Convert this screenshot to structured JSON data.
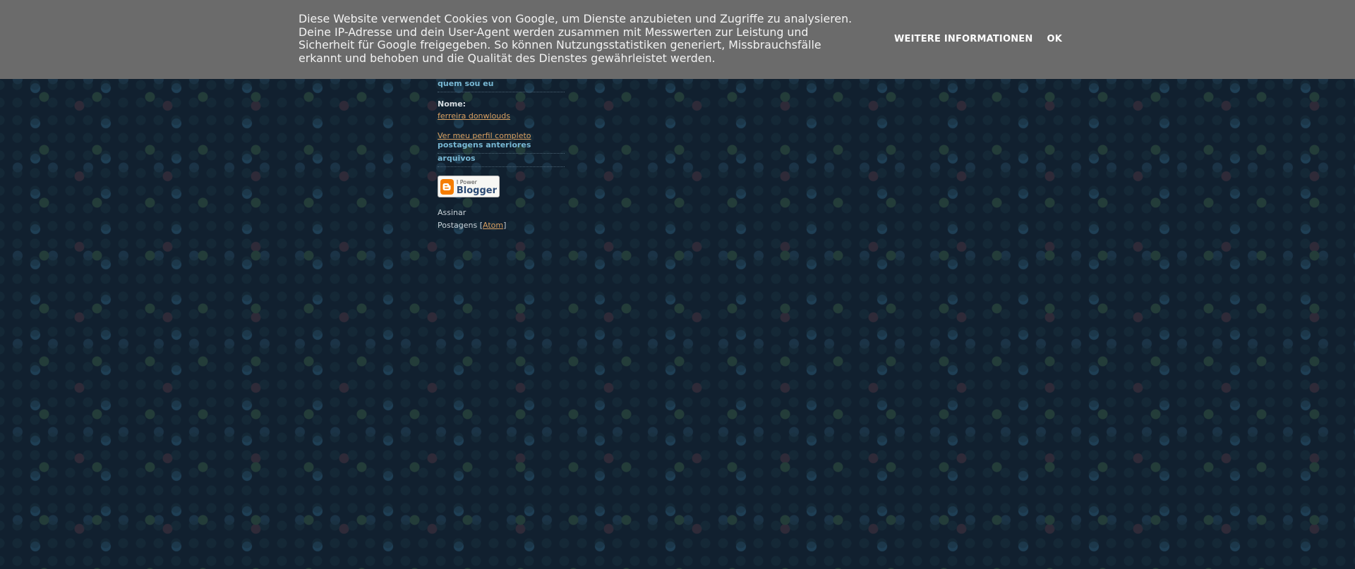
{
  "cookie_banner": {
    "text": "Diese Website verwendet Cookies von Google, um Dienste anzubieten und Zugriffe zu analysieren.\nDeine IP-Adresse und dein User-Agent werden zusammen mit Messwerten zur Leistung und\nSicherheit für Google freigegeben. So können Nutzungsstatistiken generiert, Missbrauchsfälle\nerkannt und behoben und die Qualität des Dienstes gewährleistet werden.",
    "more_info_label": "Weitere Informationen",
    "ok_label": "OK"
  },
  "sidebar": {
    "about_title": "quem sou eu",
    "name_label": "Nome:",
    "name_value": "ferreira donwlouds",
    "profile_link": "Ver meu perfil completo",
    "previous_posts_title": "postagens anteriores",
    "archives_title": "arquivos",
    "badge": {
      "small_text": "I Power",
      "big_text": "Blogger",
      "icon": "blogger-logo-icon",
      "color": "#f57d00"
    },
    "subscribe_label": "Assinar",
    "posts_label": "Postagens [",
    "atom_label": "Atom",
    "posts_close": "]"
  },
  "colors": {
    "background": "#11202f",
    "banner": "#6b6b6b",
    "heading": "#78b8d4",
    "link": "#d9a062"
  }
}
